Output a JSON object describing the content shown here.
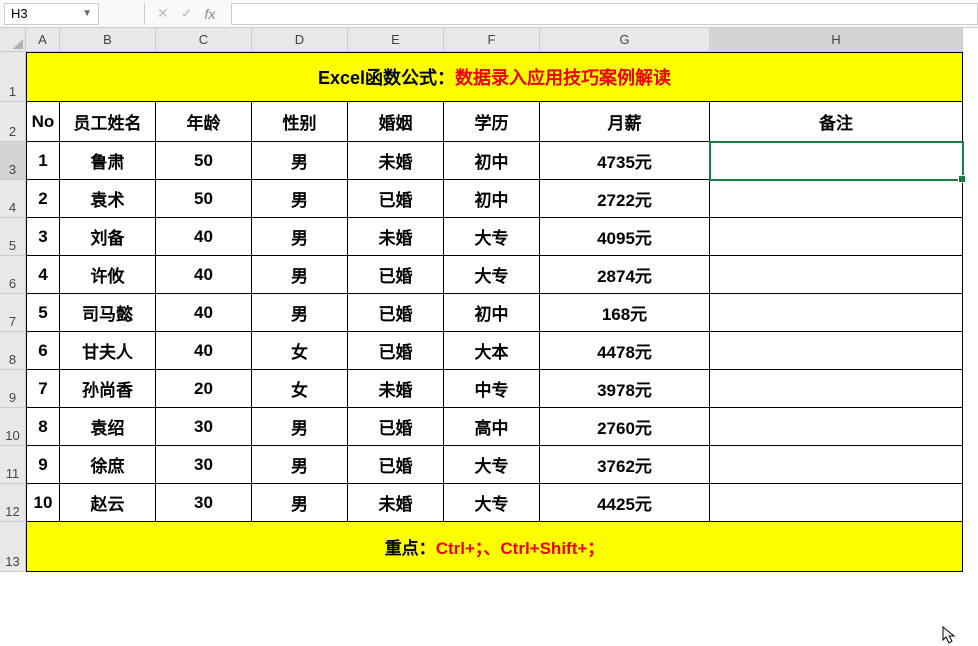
{
  "name_box": "H3",
  "title": {
    "black": "Excel函数公式：",
    "red": "数据录入应用技巧案例解读"
  },
  "columns": [
    "A",
    "B",
    "C",
    "D",
    "E",
    "F",
    "G",
    "H"
  ],
  "row_numbers": [
    "1",
    "2",
    "3",
    "4",
    "5",
    "6",
    "7",
    "8",
    "9",
    "10",
    "11",
    "12",
    "13"
  ],
  "headers": {
    "no": "No",
    "name": "员工姓名",
    "age": "年龄",
    "gender": "性别",
    "marriage": "婚姻",
    "education": "学历",
    "salary": "月薪",
    "remark": "备注"
  },
  "rows": [
    {
      "no": "1",
      "name": "鲁肃",
      "age": "50",
      "gender": "男",
      "marriage": "未婚",
      "education": "初中",
      "salary": "4735元",
      "remark": ""
    },
    {
      "no": "2",
      "name": "袁术",
      "age": "50",
      "gender": "男",
      "marriage": "已婚",
      "education": "初中",
      "salary": "2722元",
      "remark": ""
    },
    {
      "no": "3",
      "name": "刘备",
      "age": "40",
      "gender": "男",
      "marriage": "未婚",
      "education": "大专",
      "salary": "4095元",
      "remark": ""
    },
    {
      "no": "4",
      "name": "许攸",
      "age": "40",
      "gender": "男",
      "marriage": "已婚",
      "education": "大专",
      "salary": "2874元",
      "remark": ""
    },
    {
      "no": "5",
      "name": "司马懿",
      "age": "40",
      "gender": "男",
      "marriage": "已婚",
      "education": "初中",
      "salary": "168元",
      "remark": ""
    },
    {
      "no": "6",
      "name": "甘夫人",
      "age": "40",
      "gender": "女",
      "marriage": "已婚",
      "education": "大本",
      "salary": "4478元",
      "remark": ""
    },
    {
      "no": "7",
      "name": "孙尚香",
      "age": "20",
      "gender": "女",
      "marriage": "未婚",
      "education": "中专",
      "salary": "3978元",
      "remark": ""
    },
    {
      "no": "8",
      "name": "袁绍",
      "age": "30",
      "gender": "男",
      "marriage": "已婚",
      "education": "高中",
      "salary": "2760元",
      "remark": ""
    },
    {
      "no": "9",
      "name": "徐庶",
      "age": "30",
      "gender": "男",
      "marriage": "已婚",
      "education": "大专",
      "salary": "3762元",
      "remark": ""
    },
    {
      "no": "10",
      "name": "赵云",
      "age": "30",
      "gender": "男",
      "marriage": "未婚",
      "education": "大专",
      "salary": "4425元",
      "remark": ""
    }
  ],
  "footer": {
    "black": "重点：",
    "red": "Ctrl+；、Ctrl+Shift+；"
  },
  "selected_cell": "H3",
  "active_column": "H",
  "active_row": "3"
}
